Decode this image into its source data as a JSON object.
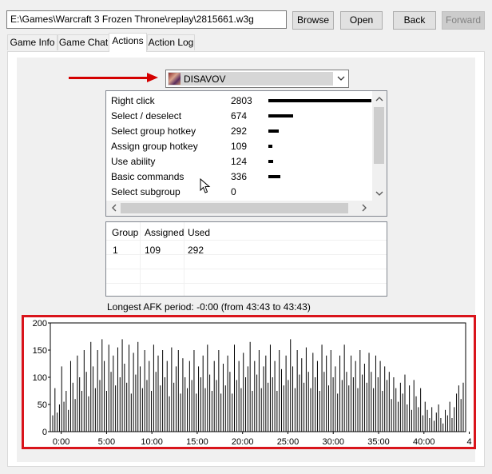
{
  "toolbar": {
    "path": "E:\\Games\\Warcraft 3 Frozen Throne\\replay\\2815661.w3g",
    "browse_label": "Browse",
    "open_label": "Open",
    "back_label": "Back",
    "forward_label": "Forward"
  },
  "tabs": [
    {
      "label": "Game Info",
      "active": false
    },
    {
      "label": "Game Chat",
      "active": false
    },
    {
      "label": "Actions",
      "active": true
    },
    {
      "label": "Action Log",
      "active": false
    }
  ],
  "player": {
    "name": "DISAVOV"
  },
  "actions": [
    {
      "name": "Right click",
      "count": 2803
    },
    {
      "name": "Select / deselect",
      "count": 674
    },
    {
      "name": "Select group hotkey",
      "count": 292
    },
    {
      "name": "Assign group hotkey",
      "count": 109
    },
    {
      "name": "Use ability",
      "count": 124
    },
    {
      "name": "Basic commands",
      "count": 336
    },
    {
      "name": "Select subgroup",
      "count": 0
    }
  ],
  "groups": {
    "headers": {
      "group": "Group",
      "assigned": "Assigned",
      "used": "Used"
    },
    "rows": [
      {
        "group": "1",
        "assigned": "109",
        "used": "292"
      }
    ]
  },
  "afk": {
    "text": "Longest AFK period: -0:00 (from 43:43 to 43:43)"
  },
  "colors": {
    "highlight_red": "#d9141b",
    "arrow_red": "#d40000"
  },
  "chart_data": {
    "type": "bar",
    "y_ticks": [
      "200",
      "150",
      "100",
      "50",
      "0"
    ],
    "ylim": [
      0,
      200
    ],
    "x_ticks": [
      "0:00",
      "5:00",
      "10:00",
      "15:00",
      "20:00",
      "25:00",
      "30:00",
      "35:00",
      "40:00",
      "4"
    ],
    "x_tick_minutes": [
      0,
      5,
      10,
      15,
      20,
      25,
      30,
      35,
      40,
      45
    ],
    "xlim_minutes": [
      -1.2,
      44.6
    ],
    "values": [
      30,
      80,
      35,
      50,
      120,
      55,
      75,
      40,
      130,
      90,
      60,
      140,
      100,
      75,
      150,
      110,
      65,
      165,
      120,
      80,
      150,
      95,
      170,
      130,
      75,
      160,
      110,
      140,
      85,
      155,
      100,
      170,
      125,
      90,
      160,
      70,
      145,
      105,
      165,
      120,
      80,
      150,
      95,
      130,
      75,
      160,
      110,
      140,
      85,
      150,
      100,
      130,
      65,
      155,
      90,
      120,
      150,
      70,
      135,
      100,
      80,
      130,
      95,
      150,
      70,
      120,
      100,
      140,
      80,
      160,
      105,
      75,
      130,
      95,
      150,
      70,
      125,
      85,
      140,
      110,
      70,
      160,
      95,
      130,
      80,
      145,
      100,
      120,
      165,
      75,
      130,
      105,
      150,
      80,
      120,
      140,
      90,
      160,
      100,
      130,
      75,
      150,
      115,
      85,
      140,
      95,
      170,
      120,
      80,
      150,
      105,
      135,
      90,
      155,
      110,
      80,
      145,
      100,
      130,
      75,
      160,
      110,
      140,
      85,
      150,
      100,
      120,
      70,
      140,
      95,
      160,
      110,
      85,
      140,
      100,
      130,
      80,
      150,
      105,
      125,
      90,
      145,
      110,
      80,
      140,
      100,
      130,
      75,
      120,
      95,
      110,
      60,
      100,
      80,
      55,
      90,
      70,
      105,
      50,
      85,
      40,
      95,
      65,
      45,
      80,
      30,
      55,
      40,
      25,
      45,
      20,
      35,
      50,
      25,
      15,
      40,
      30,
      55,
      25,
      45,
      70,
      85,
      60,
      90
    ]
  }
}
